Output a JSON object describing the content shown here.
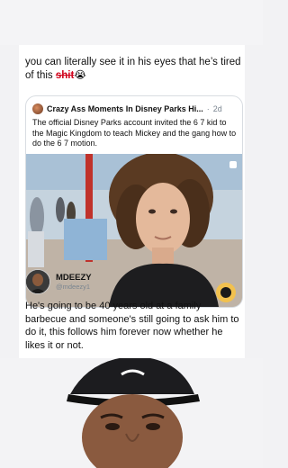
{
  "caption": {
    "text_before": "you can literally see it in his eyes that he’s tired of this ",
    "strike_word": "shit",
    "emoji": "😭"
  },
  "quoted_post": {
    "account_name": "Crazy Ass Moments In Disney Parks Hi...",
    "separator": "·",
    "age": "2d",
    "text": "The official Disney Parks account invited the 6 7 kid to the Magic Kingdom to teach Mickey and the gang how to do the 6 7 motion."
  },
  "author": {
    "name": "MDEEZY",
    "handle": "@mdeezy1"
  },
  "body_text": "He's going to be 40 years old at a family barbecue and someone's still going to ask him to do it, this follows him forever now whether he likes it or not."
}
